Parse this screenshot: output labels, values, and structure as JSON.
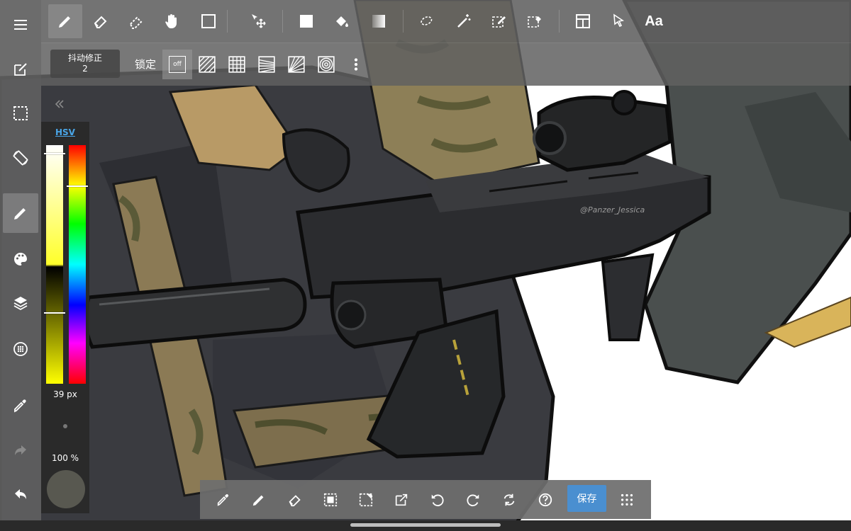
{
  "canvas": {
    "artwork_name": "tactical-smg-illustration",
    "signature_text": "@Panzer_Jessica"
  },
  "left_toolbar": {
    "items": [
      {
        "name": "menu",
        "icon": "menu-icon"
      },
      {
        "name": "edit",
        "icon": "edit-icon"
      },
      {
        "name": "selection",
        "icon": "selection-icon"
      },
      {
        "name": "rotate-screen",
        "icon": "screen-rotate-icon"
      },
      {
        "name": "brush",
        "icon": "brush-icon",
        "active": true
      },
      {
        "name": "palette",
        "icon": "palette-icon"
      },
      {
        "name": "layers",
        "icon": "layers-icon"
      },
      {
        "name": "brush-settings",
        "icon": "dots-circle-icon"
      },
      {
        "name": "eyedropper",
        "icon": "eyedropper-icon"
      },
      {
        "name": "redo",
        "icon": "redo-icon",
        "disabled": true
      },
      {
        "name": "undo",
        "icon": "undo-icon"
      }
    ]
  },
  "top_toolbar": {
    "items": [
      "pencil",
      "eraser",
      "blur",
      "hand",
      "shape",
      "move",
      "fill-rect",
      "bucket",
      "gradient",
      "lasso",
      "magic-wand",
      "select-pen",
      "select-eraser",
      "frame-divider",
      "pointer",
      "text"
    ],
    "text_label": "Aa"
  },
  "sub_toolbar": {
    "stabilizer_label": "抖动修正",
    "stabilizer_value": "2",
    "lock_label": "锁定",
    "lock_off_label": "off"
  },
  "color_panel": {
    "mode_label": "HSV",
    "brush_size": "39 px",
    "opacity": "100 %",
    "current_color": "#585850"
  },
  "bottom_toolbar": {
    "items": [
      "eyedropper",
      "pen",
      "eraser",
      "select-all",
      "deselect",
      "transform",
      "undo",
      "redo",
      "flip",
      "help"
    ],
    "save_label": "保存"
  }
}
